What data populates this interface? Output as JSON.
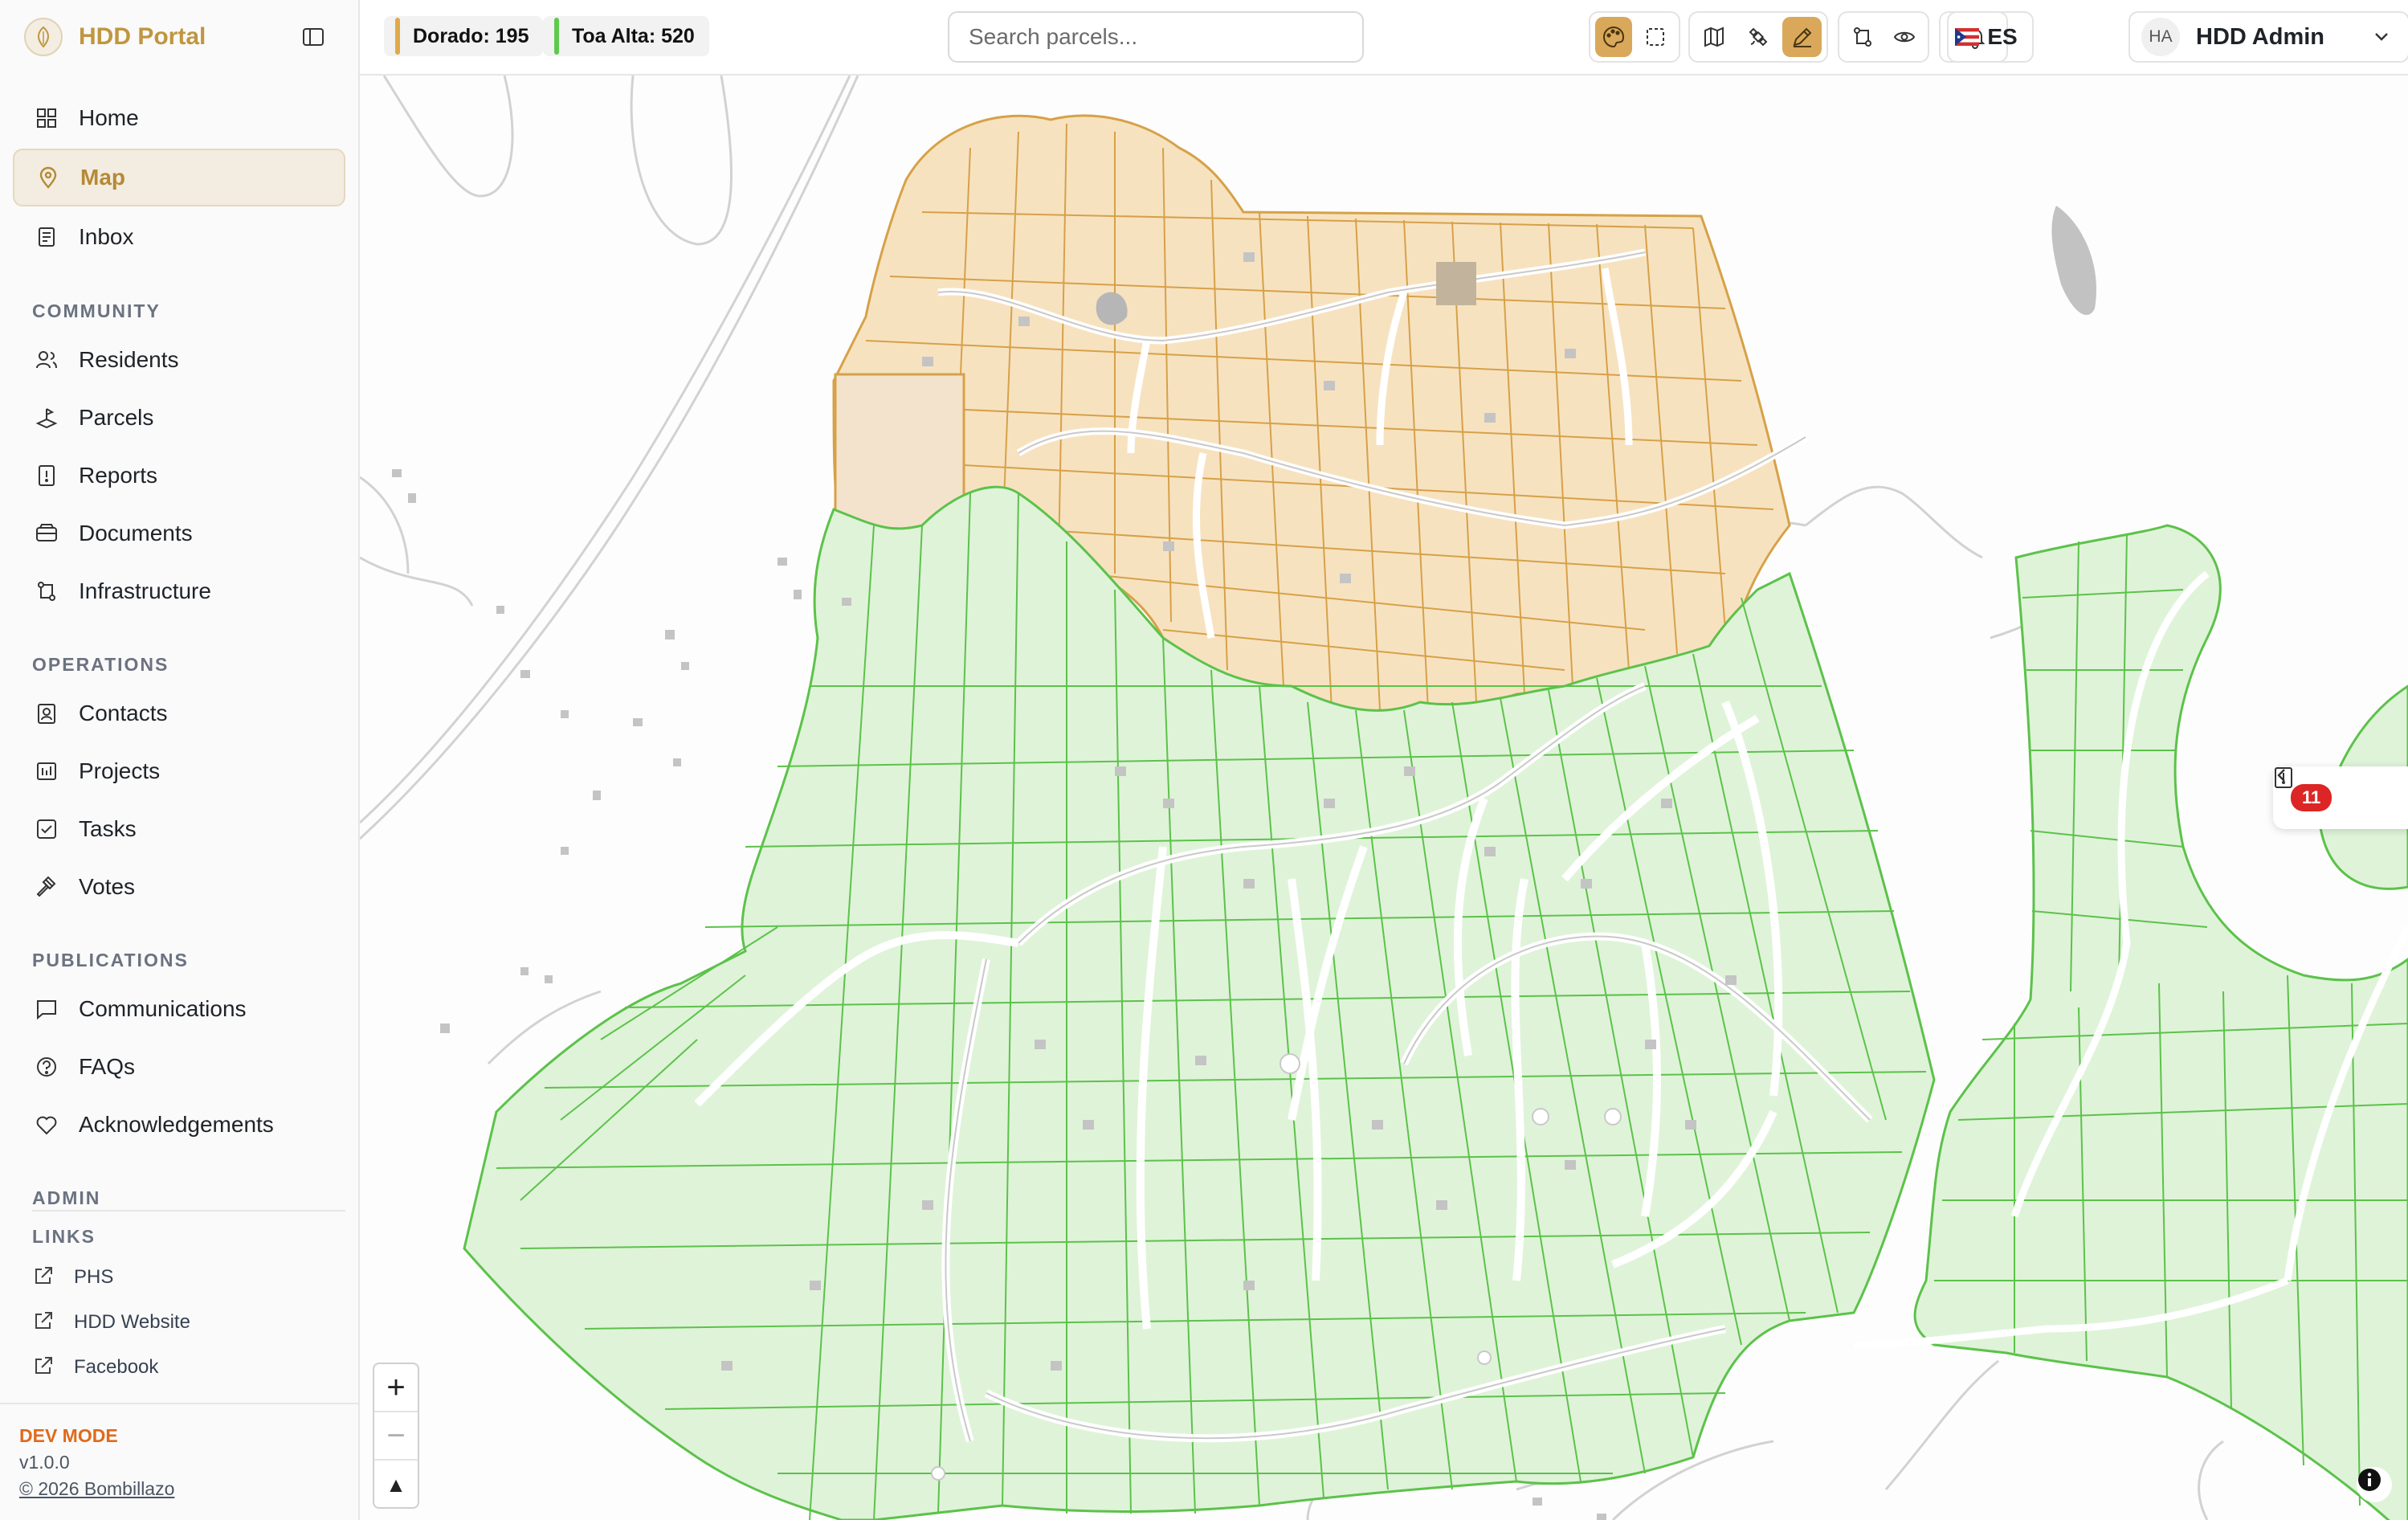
{
  "app": {
    "name": "HDD Portal"
  },
  "nav": {
    "main": [
      {
        "id": "home",
        "label": "Home",
        "icon": "grid-icon"
      },
      {
        "id": "map",
        "label": "Map",
        "icon": "map-pin-icon",
        "active": true
      },
      {
        "id": "inbox",
        "label": "Inbox",
        "icon": "inbox-icon"
      }
    ],
    "community": {
      "title": "COMMUNITY",
      "items": [
        {
          "id": "residents",
          "label": "Residents",
          "icon": "users-icon"
        },
        {
          "id": "parcels",
          "label": "Parcels",
          "icon": "parcel-icon"
        },
        {
          "id": "reports",
          "label": "Reports",
          "icon": "report-icon"
        },
        {
          "id": "documents",
          "label": "Documents",
          "icon": "folder-icon"
        },
        {
          "id": "infrastructure",
          "label": "Infrastructure",
          "icon": "route-icon"
        }
      ]
    },
    "operations": {
      "title": "OPERATIONS",
      "items": [
        {
          "id": "contacts",
          "label": "Contacts",
          "icon": "contact-icon"
        },
        {
          "id": "projects",
          "label": "Projects",
          "icon": "chart-icon"
        },
        {
          "id": "tasks",
          "label": "Tasks",
          "icon": "checkbox-icon"
        },
        {
          "id": "votes",
          "label": "Votes",
          "icon": "gavel-icon"
        }
      ]
    },
    "publications": {
      "title": "PUBLICATIONS",
      "items": [
        {
          "id": "communications",
          "label": "Communications",
          "icon": "message-icon"
        },
        {
          "id": "faqs",
          "label": "FAQs",
          "icon": "help-icon"
        },
        {
          "id": "acknowledgements",
          "label": "Acknowledgements",
          "icon": "heart-icon"
        }
      ]
    },
    "admin": {
      "title": "ADMIN"
    },
    "links": {
      "title": "LINKS",
      "items": [
        {
          "id": "phs",
          "label": "PHS"
        },
        {
          "id": "hdd-website",
          "label": "HDD Website"
        },
        {
          "id": "facebook",
          "label": "Facebook"
        }
      ]
    }
  },
  "footer": {
    "mode": "DEV MODE",
    "version": "v1.0.0",
    "copyright": "© 2026 Bombillazo"
  },
  "topbar": {
    "chips": [
      {
        "label": "Dorado: 195",
        "color": "#e0a94a"
      },
      {
        "label": "Toa Alta: 520",
        "color": "#5fc94e"
      }
    ],
    "search": {
      "placeholder": "Search parcels...",
      "value": ""
    },
    "language": "ES",
    "user": {
      "initials": "HA",
      "name": "HDD Admin"
    }
  },
  "map": {
    "zoom_in": "+",
    "zoom_out": "−",
    "reset_north": "▲",
    "reports_badge": "11",
    "colors": {
      "dorado_fill": "#f7e2c0",
      "dorado_stroke": "#d6a148",
      "toa_fill": "#dff3d9",
      "toa_stroke": "#5cc24a",
      "road": "#d4d4d4"
    }
  }
}
